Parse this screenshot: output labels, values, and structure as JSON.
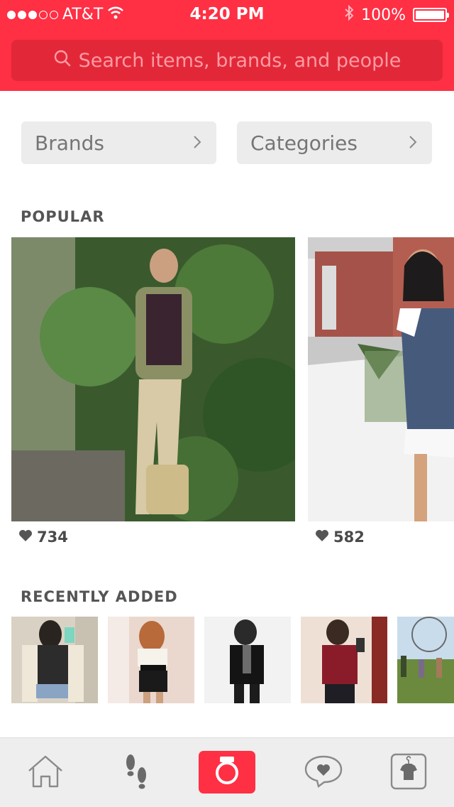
{
  "status_bar": {
    "carrier": "AT&T",
    "time": "4:20 PM",
    "battery": "100%",
    "signal_bars_filled": 3,
    "signal_bars_total": 5
  },
  "search": {
    "placeholder": "Search items, brands, and people",
    "icon": "search-icon"
  },
  "filters": {
    "brands_label": "Brands",
    "categories_label": "Categories"
  },
  "popular": {
    "title": "POPULAR",
    "items": [
      {
        "likes": "734",
        "photo": "woman-olive-jacket-ivy-wall"
      },
      {
        "likes": "582",
        "photo": "woman-navy-dress-sidewalk"
      }
    ]
  },
  "recently_added": {
    "title": "RECENTLY ADDED",
    "items": [
      {
        "photo": "selfie-cardigan-shorts"
      },
      {
        "photo": "selfie-peplum-top"
      },
      {
        "photo": "black-blazer-outfit"
      },
      {
        "photo": "red-sweater-selfie"
      },
      {
        "photo": "festival-crowd"
      }
    ]
  },
  "tab_bar": {
    "items": [
      "home-icon",
      "footsteps-icon",
      "camera-icon",
      "chat-heart-icon",
      "closet-icon"
    ]
  },
  "colors": {
    "brand": "#ff2f44",
    "search_bg": "#e22838",
    "pill_bg": "#ececec",
    "tabbar_bg": "#eeeeee"
  }
}
